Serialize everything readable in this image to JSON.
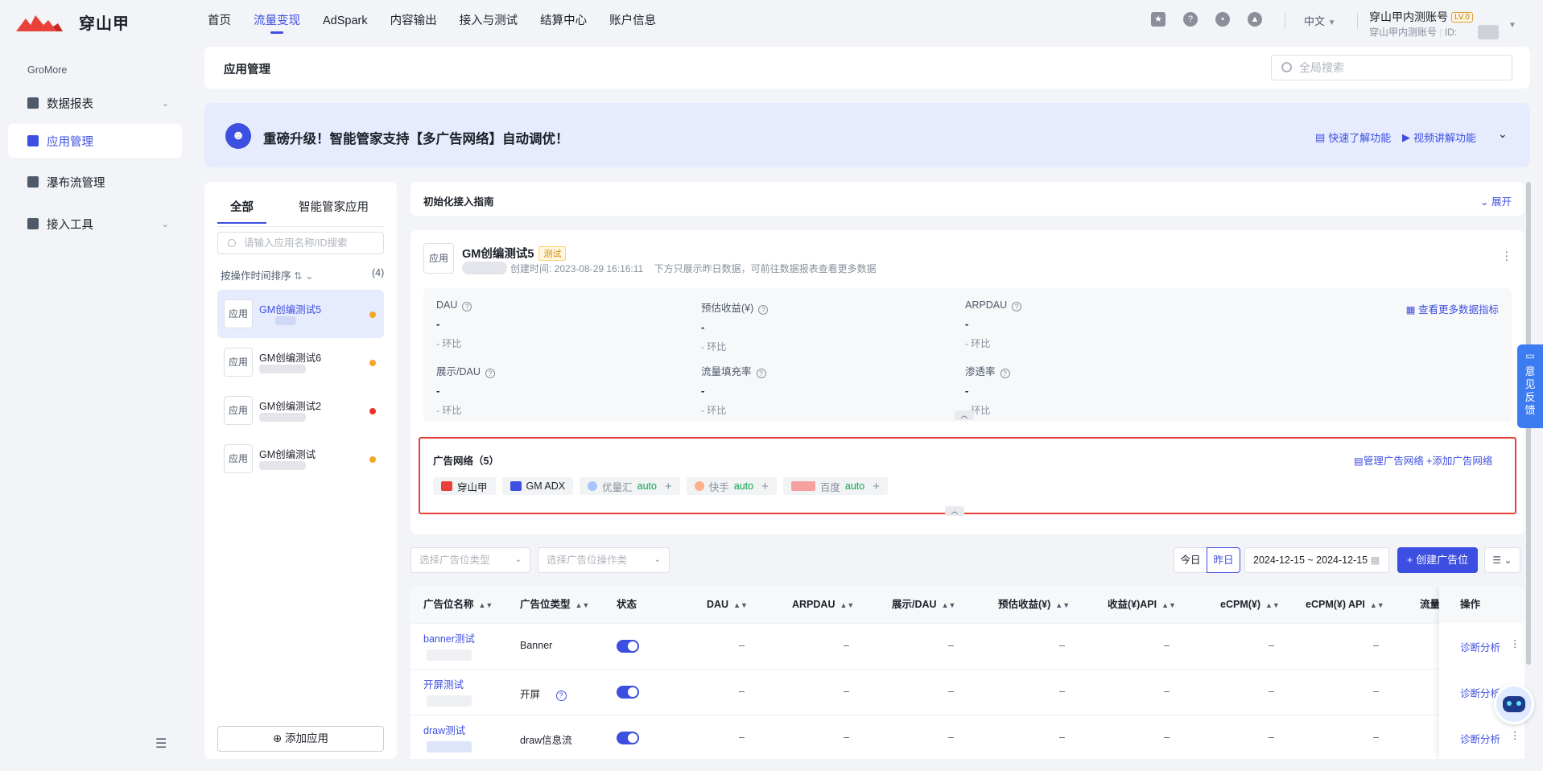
{
  "brand": {
    "name": "穿山甲"
  },
  "nav": {
    "items": [
      "首页",
      "流量变现",
      "AdSpark",
      "内容输出",
      "接入与测试",
      "结算中心",
      "账户信息"
    ],
    "active": "流量变现"
  },
  "header": {
    "lang": "中文",
    "account_name": "穿山甲内测账号",
    "level": "LV.0",
    "account_sub": "穿山甲内测账号",
    "id_label": "ID:"
  },
  "sidebar": {
    "section": "GroMore",
    "items": [
      {
        "label": "数据报表",
        "icon": "video-icon",
        "expandable": true
      },
      {
        "label": "应用管理",
        "icon": "grid-icon",
        "active": true
      },
      {
        "label": "瀑布流管理",
        "icon": "layers-icon"
      },
      {
        "label": "接入工具",
        "icon": "toolbox-icon",
        "expandable": true
      }
    ]
  },
  "page": {
    "title": "应用管理",
    "search_placeholder": "全局搜索"
  },
  "banner": {
    "text": "重磅升级！智能管家支持【多广告网络】自动调优！",
    "link1": "快速了解功能",
    "link2": "视频讲解功能"
  },
  "apps_panel": {
    "tabs": [
      "全部",
      "智能管家应用"
    ],
    "search_placeholder": "请输入应用名称/ID搜索",
    "sort_label": "按操作时间排序",
    "count": "(4)",
    "icon_text": "应用",
    "apps": [
      {
        "name": "GM创编测试5",
        "status_color": "#f5a524",
        "active": true
      },
      {
        "name": "GM创编测试6",
        "status_color": "#f5a524"
      },
      {
        "name": "GM创编测试2",
        "status_color": "#f0302c"
      },
      {
        "name": "GM创编测试",
        "status_color": "#f5a524"
      }
    ],
    "add_button": "添加应用"
  },
  "guide": {
    "title": "初始化接入指南",
    "expand": "展开"
  },
  "app_card": {
    "icon_text": "应用",
    "name": "GM创编测试5",
    "tag": "测试",
    "created": "创建时间: 2023-08-29 16:16:11",
    "note": "下方只展示昨日数据，可前往数据报表查看更多数据",
    "more_metrics": "查看更多数据指标",
    "metrics": [
      {
        "label": "DAU",
        "value": "-",
        "compare": "-  环比"
      },
      {
        "label": "预估收益(¥)",
        "value": "-",
        "compare": "-  环比"
      },
      {
        "label": "ARPDAU",
        "value": "-",
        "compare": "-  环比"
      },
      {
        "label": "展示/DAU",
        "value": "-",
        "compare": "-  环比"
      },
      {
        "label": "流量填充率",
        "value": "-",
        "compare": "-  环比"
      },
      {
        "label": "渗透率",
        "value": "-",
        "compare": "-  环比"
      }
    ]
  },
  "ad_networks": {
    "title": "广告网络（5）",
    "manage": "管理广告网络",
    "add": "添加广告网络",
    "chips": [
      {
        "name": "穿山甲",
        "auto": "",
        "dim": false,
        "icon_color": "#e8413a"
      },
      {
        "name": "GM ADX",
        "auto": "",
        "dim": false,
        "icon_color": "#3d4fe0"
      },
      {
        "name": "优量汇",
        "auto": "auto",
        "dim": true,
        "icon_color": "#a8c4ff"
      },
      {
        "name": "快手",
        "auto": "auto",
        "dim": true,
        "icon_color": "#ffb08a"
      },
      {
        "name": "百度",
        "auto": "auto",
        "dim": true,
        "icon_color": "#f6a0a0"
      }
    ]
  },
  "filters": {
    "type_placeholder": "选择广告位类型",
    "op_placeholder": "选择广告位操作类",
    "today": "今日",
    "yesterday": "昨日",
    "date_range": "2024-12-15 ~ 2024-12-15",
    "create": "+ 创建广告位"
  },
  "table": {
    "headers": [
      "广告位名称",
      "广告位类型",
      "状态",
      "DAU",
      "ARPDAU",
      "展示/DAU",
      "预估收益(¥)",
      "收益(¥)API",
      "eCPM(¥)",
      "eCPM(¥) API",
      "流量",
      "操作"
    ],
    "rows": [
      {
        "name": "banner测试",
        "type": "Banner",
        "vals": [
          "–",
          "–",
          "–",
          "–",
          "–",
          "–",
          "–"
        ],
        "op": "诊断分析"
      },
      {
        "name": "开屏测试",
        "type": "开屏",
        "vals": [
          "–",
          "–",
          "–",
          "–",
          "–",
          "–",
          "–"
        ],
        "op": "诊断分析"
      },
      {
        "name": "draw测试",
        "type": "draw信息流",
        "vals": [
          "–",
          "–",
          "–",
          "–",
          "–",
          "–",
          "–"
        ],
        "op": "诊断分析"
      }
    ]
  },
  "feedback": {
    "label": "意见反馈"
  }
}
